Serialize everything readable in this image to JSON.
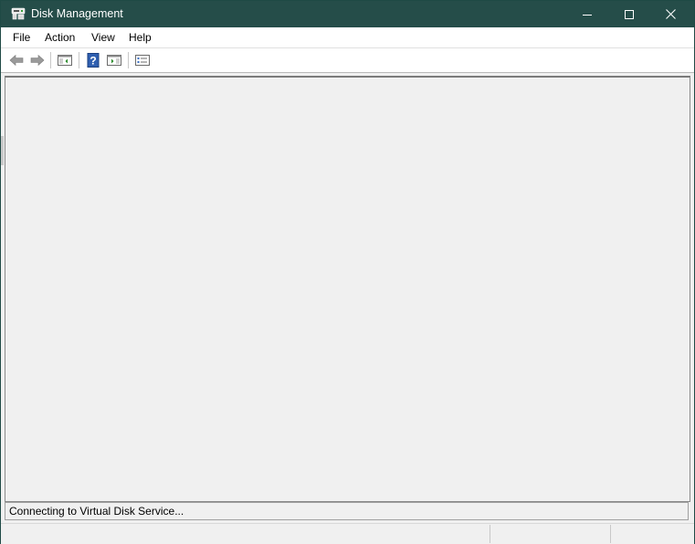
{
  "window": {
    "title": "Disk Management",
    "titlebar_color": "#254d49",
    "controls": [
      "minimize-icon",
      "maximize-icon",
      "close-icon"
    ]
  },
  "menubar": {
    "items": [
      {
        "label": "File"
      },
      {
        "label": "Action"
      },
      {
        "label": "View"
      },
      {
        "label": "Help"
      }
    ]
  },
  "toolbar": {
    "buttons": [
      {
        "icon": "back-arrow-icon"
      },
      {
        "icon": "forward-arrow-icon"
      },
      {
        "icon": "show-hide-console-tree-icon"
      },
      {
        "icon": "help-icon"
      },
      {
        "icon": "show-hide-action-pane-icon"
      },
      {
        "icon": "properties-icon"
      }
    ]
  },
  "status": {
    "message": "Connecting to Virtual Disk Service..."
  }
}
